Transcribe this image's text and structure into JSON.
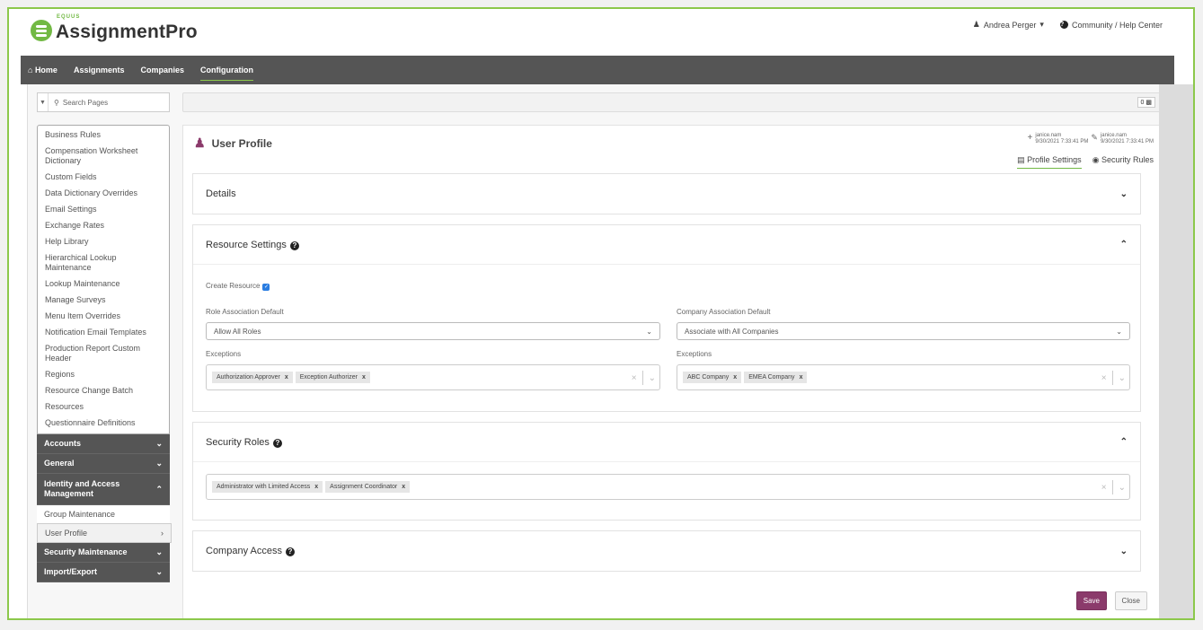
{
  "app": {
    "brand_small": "EQUUS",
    "brand": "AssignmentPro"
  },
  "header": {
    "user": "Andrea Perger",
    "help": "Community / Help Center"
  },
  "nav": {
    "items": [
      {
        "label": "Home",
        "icon": "home-icon"
      },
      {
        "label": "Assignments"
      },
      {
        "label": "Companies"
      },
      {
        "label": "Configuration",
        "active": true
      }
    ]
  },
  "search": {
    "placeholder": "Search Pages"
  },
  "toolbar": {
    "count": "0"
  },
  "sidebar": {
    "items": [
      "Business Rules",
      "Compensation Worksheet Dictionary",
      "Custom Fields",
      "Data Dictionary Overrides",
      "Email Settings",
      "Exchange Rates",
      "Help Library",
      "Hierarchical Lookup Maintenance",
      "Lookup Maintenance",
      "Manage Surveys",
      "Menu Item Overrides",
      "Notification Email Templates",
      "Production Report Custom Header",
      "Regions",
      "Resource Change Batch",
      "Resources",
      "Questionnaire Definitions"
    ],
    "groups": {
      "accounts": "Accounts",
      "general": "General",
      "iam": "Identity and Access Management",
      "iam_children": [
        "Group Maintenance",
        "User Profile"
      ],
      "security": "Security Maintenance",
      "importexport": "Import/Export"
    }
  },
  "page": {
    "title": "User Profile",
    "created_by": "janice.nam",
    "created_at": "9/30/2021 7:33:41 PM",
    "modified_by": "janice.nam",
    "modified_at": "9/30/2021 7:33:41 PM",
    "tabs": [
      "Profile Settings",
      "Security Rules"
    ],
    "active_tab": "Profile Settings"
  },
  "panels": {
    "details": "Details",
    "resource": {
      "title": "Resource Settings",
      "create_resource": "Create Resource",
      "create_resource_checked": true,
      "role_label": "Role Association Default",
      "role_value": "Allow All Roles",
      "company_label": "Company Association Default",
      "company_value": "Associate with All Companies",
      "exceptions_label": "Exceptions",
      "role_exceptions": [
        "Authorization Approver",
        "Exception Authorizer"
      ],
      "company_exceptions": [
        "ABC Company",
        "EMEA Company"
      ]
    },
    "security": {
      "title": "Security Roles",
      "roles": [
        "Administrator with Limited Access",
        "Assignment Coordinator"
      ]
    },
    "company_access": "Company Access"
  },
  "buttons": {
    "save": "Save",
    "close": "Close"
  },
  "colors": {
    "brand_green": "#72b944",
    "accent_purple": "#8b3a6b",
    "nav_bg": "#555555"
  }
}
